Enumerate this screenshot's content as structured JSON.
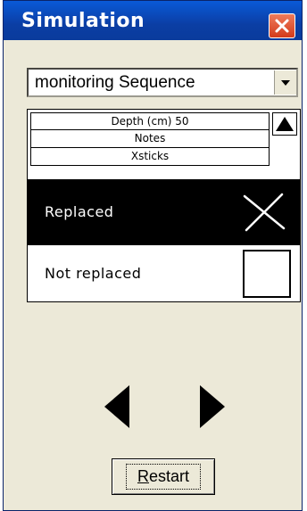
{
  "window": {
    "title": "Simulation",
    "close_icon": "close-icon"
  },
  "sequence_select": {
    "value": "monitoring Sequence",
    "arrow_icon": "chevron-down-icon"
  },
  "list": {
    "rows": [
      "Depth (cm) 50",
      "Notes",
      "Xsticks"
    ],
    "scroll_icon": "triangle-up-icon"
  },
  "options": {
    "replaced_label": "Replaced",
    "not_replaced_label": "Not replaced",
    "selected": "Replaced"
  },
  "navigation": {
    "prev_icon": "triangle-left-icon",
    "next_icon": "triangle-right-icon"
  },
  "restart": {
    "label_mnemonic": "R",
    "label_rest": "estart"
  },
  "colors": {
    "titlebar": "#0b3ea4",
    "close": "#d33b1b",
    "face": "#ece9d8",
    "selected_bg": "#000000"
  }
}
